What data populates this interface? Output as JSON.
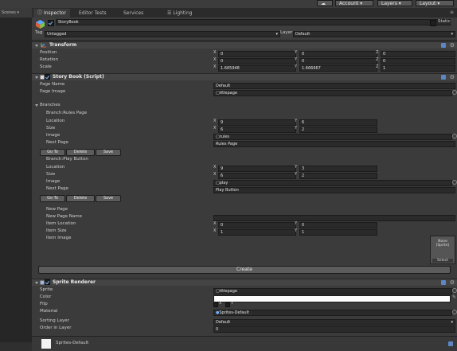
{
  "topbar": {
    "account": "Account",
    "layers": "Layers",
    "layout": "Layout"
  },
  "left_panel": {
    "title": "Scenes"
  },
  "tabs": [
    {
      "label": "Inspector",
      "active": true
    },
    {
      "label": "Editor Tests",
      "active": false
    },
    {
      "label": "Services",
      "active": false
    },
    {
      "label": "Lighting",
      "active": false
    }
  ],
  "object": {
    "name": "StoryBook",
    "static_label": "Static",
    "tag_label": "Tag",
    "tag_value": "Untagged",
    "layer_label": "Layer",
    "layer_value": "Default"
  },
  "transform": {
    "title": "Transform",
    "rows": [
      {
        "label": "Position",
        "x": "0",
        "y": "0",
        "z": "0"
      },
      {
        "label": "Rotation",
        "x": "0",
        "y": "0",
        "z": "0"
      },
      {
        "label": "Scale",
        "x": "1.665948",
        "y": "1.666667",
        "z": "1"
      }
    ]
  },
  "axis": {
    "x": "X",
    "y": "Y",
    "z": "Z"
  },
  "storybook": {
    "title": "Story Book (Script)",
    "page_name_label": "Page Name",
    "page_name_value": "Default",
    "page_image_label": "Page Image",
    "page_image_value": "titlepage",
    "branches_label": "Branches",
    "branches": [
      {
        "title": "Branch:Rules Page",
        "location_label": "Location",
        "location_x": "9",
        "location_y": "6",
        "size_label": "Size",
        "size_x": "6",
        "size_y": "2",
        "image_label": "Image",
        "image_value": "rules",
        "next_label": "Next Page",
        "next_value": "Rules Page",
        "goto": "Go To",
        "delete": "Delete",
        "save": "Save"
      },
      {
        "title": "Branch:Play Button",
        "location_label": "Location",
        "location_x": "9",
        "location_y": "3",
        "size_label": "Size",
        "size_x": "6",
        "size_y": "2",
        "image_label": "Image",
        "image_value": "play",
        "next_label": "Next Page",
        "next_value": "Play Button",
        "goto": "Go To",
        "delete": "Delete",
        "save": "Save"
      }
    ],
    "new_page_label": "New Page",
    "new_page_name_label": "New Page Name",
    "item_location_label": "Item Location",
    "item_location_x": "0",
    "item_location_y": "0",
    "item_size_label": "Item Size",
    "item_size_x": "1",
    "item_size_y": "1",
    "item_image_label": "Item Image",
    "preview_label": "None (Sprite)",
    "select_label": "Select",
    "create_label": "Create"
  },
  "sprite_renderer": {
    "title": "Sprite Renderer",
    "sprite_label": "Sprite",
    "sprite_value": "titlepage",
    "color_label": "Color",
    "flip_label": "Flip",
    "flip_x": "X",
    "flip_y": "Y",
    "material_label": "Material",
    "material_value": "Sprites-Default",
    "sorting_layer_label": "Sorting Layer",
    "sorting_layer_value": "Default",
    "order_label": "Order in Layer",
    "order_value": "0"
  },
  "footer": {
    "material_name": "Sprites-Default"
  },
  "colors": {
    "accent": "#6fb2ff",
    "panel": "#3b3b3b",
    "field": "#2a2a2a",
    "header": "#444444"
  }
}
